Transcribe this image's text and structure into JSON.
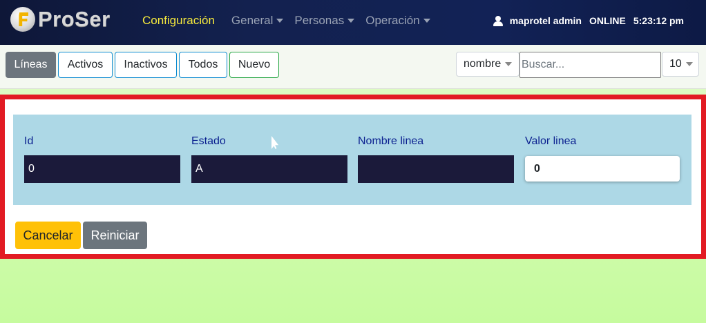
{
  "navbar": {
    "brand": "ProSer",
    "links": [
      {
        "label": "Configuración",
        "active": true,
        "has_caret": false
      },
      {
        "label": "General",
        "active": false,
        "has_caret": true
      },
      {
        "label": "Personas",
        "active": false,
        "has_caret": true
      },
      {
        "label": "Operación",
        "active": false,
        "has_caret": true
      }
    ],
    "user": "maprotel admin",
    "status": "ONLINE",
    "time": "5:23:12 pm"
  },
  "toolbar": {
    "tabs": [
      "Líneas",
      "Activos",
      "Inactivos",
      "Todos",
      "Nuevo"
    ],
    "sort_field": "nombre",
    "search_placeholder": "Buscar...",
    "page_size": "10"
  },
  "form": {
    "fields": [
      {
        "label": "Id",
        "value": "0"
      },
      {
        "label": "Estado",
        "value": "A"
      },
      {
        "label": "Nombre linea",
        "value": ""
      },
      {
        "label": "Valor linea",
        "value": "0"
      }
    ],
    "buttons": {
      "cancel": "Cancelar",
      "reset": "Reiniciar"
    }
  },
  "colors": {
    "accent_yellow": "#f8eb3c",
    "highlight_border": "#e21b23",
    "form_background": "#add8e6",
    "warning": "#ffc107",
    "secondary": "#6c757d"
  }
}
